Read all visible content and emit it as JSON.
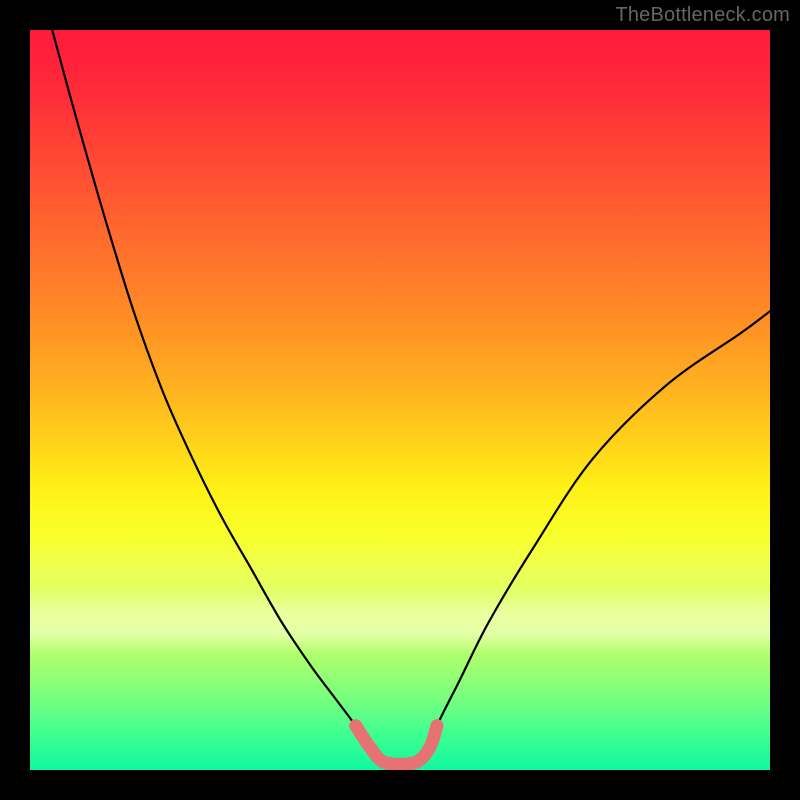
{
  "watermark": "TheBottleneck.com",
  "chart_data": {
    "type": "line",
    "title": "",
    "xlabel": "",
    "ylabel": "",
    "xlim": [
      0,
      100
    ],
    "ylim": [
      0,
      100
    ],
    "grid": false,
    "legend": false,
    "background": "rainbow-vertical",
    "series": [
      {
        "name": "black-curve",
        "color": "#000000",
        "stroke_width": 2.2,
        "x": [
          3,
          6,
          10,
          14,
          18,
          22,
          26,
          30,
          34,
          38,
          41,
          44,
          46,
          48,
          52,
          54,
          55,
          58,
          62,
          68,
          76,
          86,
          96,
          100
        ],
        "values": [
          100,
          89,
          75,
          62,
          51,
          42,
          34,
          27,
          20,
          14,
          10,
          6,
          3,
          1,
          1,
          3,
          6,
          12,
          20,
          30,
          42,
          52,
          59,
          62
        ]
      },
      {
        "name": "pink-notch",
        "color": "#e57373",
        "stroke_width": 13,
        "x": [
          44,
          46,
          48,
          52,
          54,
          55
        ],
        "values": [
          6,
          3,
          1,
          1,
          3,
          6
        ]
      }
    ]
  },
  "colors": {
    "frame": "#000000",
    "watermark": "#666666"
  }
}
